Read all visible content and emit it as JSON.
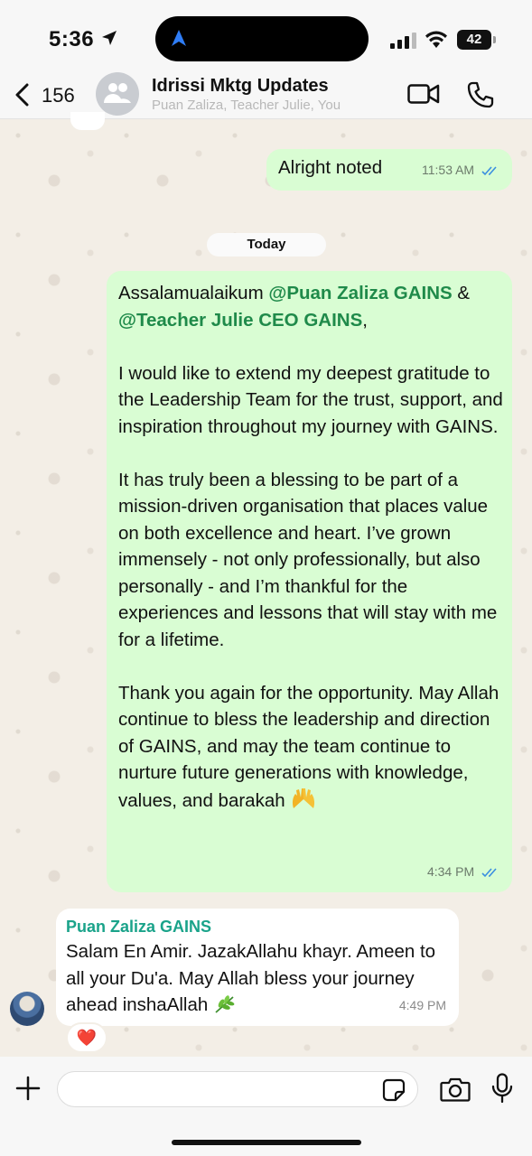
{
  "status_bar": {
    "time": "5:36",
    "battery": "42"
  },
  "header": {
    "back_count": "156",
    "title": "Idrissi Mktg Updates",
    "subtitle": "Puan Zaliza, Teacher Julie, You"
  },
  "messages": {
    "first": {
      "text": "Alright noted",
      "time": "11:53 AM"
    },
    "day_divider": "Today",
    "long": {
      "greeting": "Assalamualaikum ",
      "mention1": "@Puan Zaliza GAINS",
      "amp": " & ",
      "mention2": "@Teacher Julie CEO GAINS",
      "comma": ",",
      "para1": "I would like to extend my deepest gratitude to the Leadership Team for the trust, support, and inspiration throughout my journey with GAINS.",
      "para2": "It has truly been a blessing to be part of a mission-driven organisation that places value on both excellence and heart. I’ve grown immensely - not only professionally, but also personally - and I’m thankful for the experiences and lessons that will stay with me for a lifetime.",
      "para3": "Thank you again for the opportunity. May Allah continue to bless the leadership and direction of GAINS, and may the team continue to nurture future generations with knowledge, values, and barakah",
      "time": "4:34 PM"
    },
    "reply": {
      "sender": "Puan Zaliza GAINS",
      "text": "Salam En Amir. JazakAllahu khayr. Ameen to all your Du'a. May Allah bless your journey ahead inshaAllah",
      "time": "4:49 PM",
      "reaction": "❤️"
    }
  },
  "input": {
    "placeholder": ""
  },
  "colors": {
    "outgoing_bubble": "#d9fdd3",
    "mention": "#1f8a4a",
    "sender_name": "#1aa38a",
    "read_ticks": "#3b8fe0"
  }
}
